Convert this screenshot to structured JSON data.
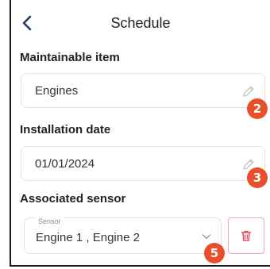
{
  "header": {
    "title": "Schedule"
  },
  "maintainable_item": {
    "label": "Maintainable item",
    "value": "Engines",
    "badge": "2"
  },
  "installation_date": {
    "label": "Installation date",
    "value": "01/01/2024",
    "badge": "3"
  },
  "associated_sensor": {
    "label": "Associated sensor",
    "field_label": "Sensor",
    "value": "Engine 1 , Engine 2",
    "badge": "5"
  },
  "colors": {
    "badge": "#e8502c",
    "delete": "#e8505b",
    "back": "#1e3a5f"
  },
  "icons": {
    "back": "chevron-left-icon",
    "edit": "pencil-icon",
    "dropdown": "chevron-down-icon",
    "delete": "trash-icon"
  }
}
